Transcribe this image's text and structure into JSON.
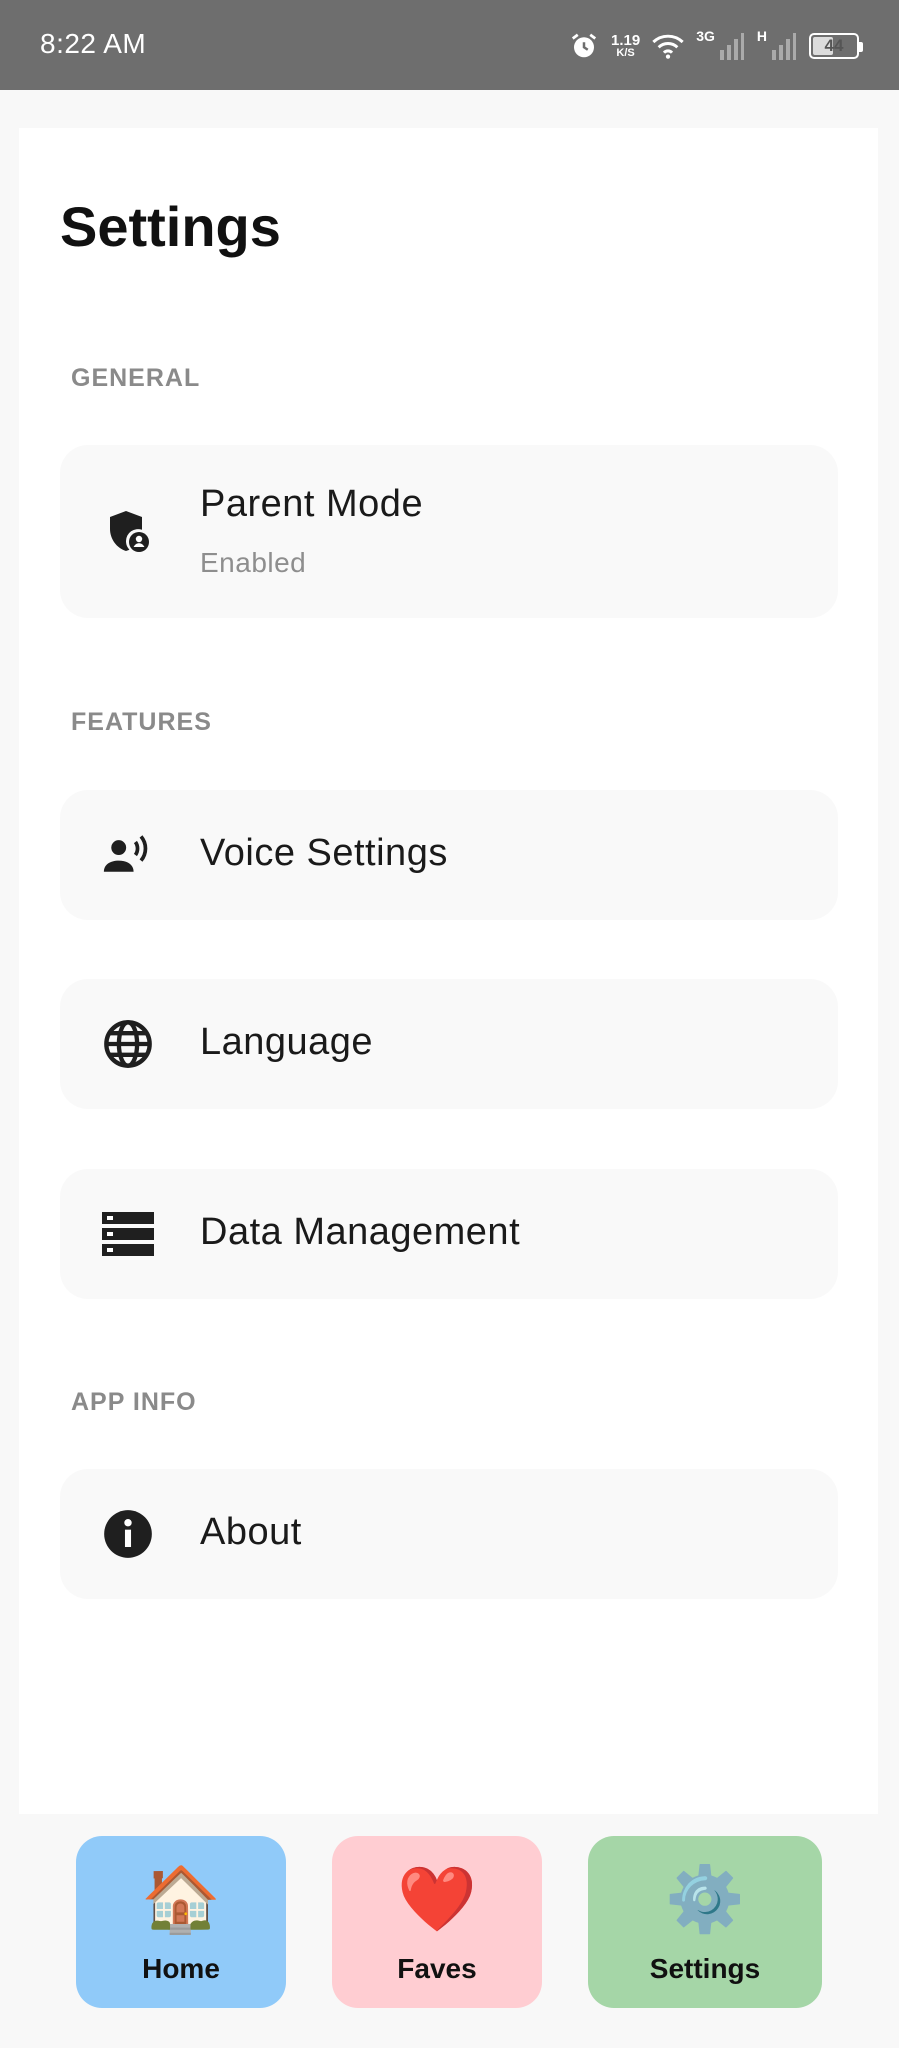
{
  "status_bar": {
    "time": "8:22 AM",
    "net_speed_value": "1.19",
    "net_speed_unit": "K/S",
    "signal_1_label": "3G",
    "signal_2_label": "H",
    "battery": "44"
  },
  "page": {
    "title": "Settings"
  },
  "sections": {
    "general": {
      "header": "GENERAL",
      "parent_mode": {
        "label": "Parent Mode",
        "sublabel": "Enabled",
        "icon": "shield-person-icon"
      }
    },
    "features": {
      "header": "FEATURES",
      "voice": {
        "label": "Voice Settings",
        "icon": "voice-person-icon"
      },
      "language": {
        "label": "Language",
        "icon": "globe-icon"
      },
      "data": {
        "label": "Data Management",
        "icon": "storage-icon"
      }
    },
    "app_info": {
      "header": "APP INFO",
      "about": {
        "label": "About",
        "icon": "info-icon"
      }
    }
  },
  "bottom_nav": {
    "home": {
      "label": "Home",
      "icon": "🏠",
      "color": "#90caf9"
    },
    "faves": {
      "label": "Faves",
      "icon": "❤️",
      "color": "#ffcdd2"
    },
    "settings": {
      "label": "Settings",
      "icon": "⚙️",
      "color": "#a5d6a7"
    }
  }
}
